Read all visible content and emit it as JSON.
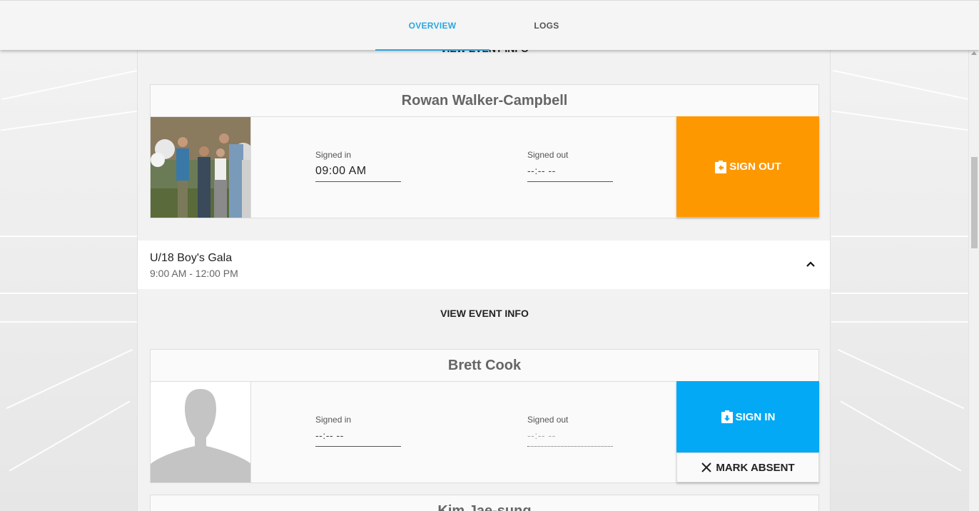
{
  "tabs": [
    {
      "label": "OVERVIEW",
      "active": true
    },
    {
      "label": "LOGS",
      "active": false
    }
  ],
  "top_link": "VIEW EVENT INFO",
  "athlete1": {
    "name": "Rowan Walker-Campbell",
    "signed_in_label": "Signed in",
    "signed_in_value": "09:00 AM",
    "signed_out_label": "Signed out",
    "signed_out_value": "--:-- --",
    "action": "SIGN OUT",
    "action_color": "#fe9800"
  },
  "event": {
    "title": "U/18 Boy's Gala",
    "time": "9:00 AM - 12:00 PM",
    "view_info": "VIEW EVENT INFO"
  },
  "athlete2": {
    "name": "Brett Cook",
    "signed_in_label": "Signed in",
    "signed_in_value": "--:-- --",
    "signed_out_label": "Signed out",
    "signed_out_value": "--:-- --",
    "action": "SIGN IN",
    "action_color": "#03a9f4",
    "secondary_action": "MARK ABSENT"
  },
  "athlete3": {
    "name": "Kim Jae-sung"
  },
  "accent_color": "#29a6e0"
}
